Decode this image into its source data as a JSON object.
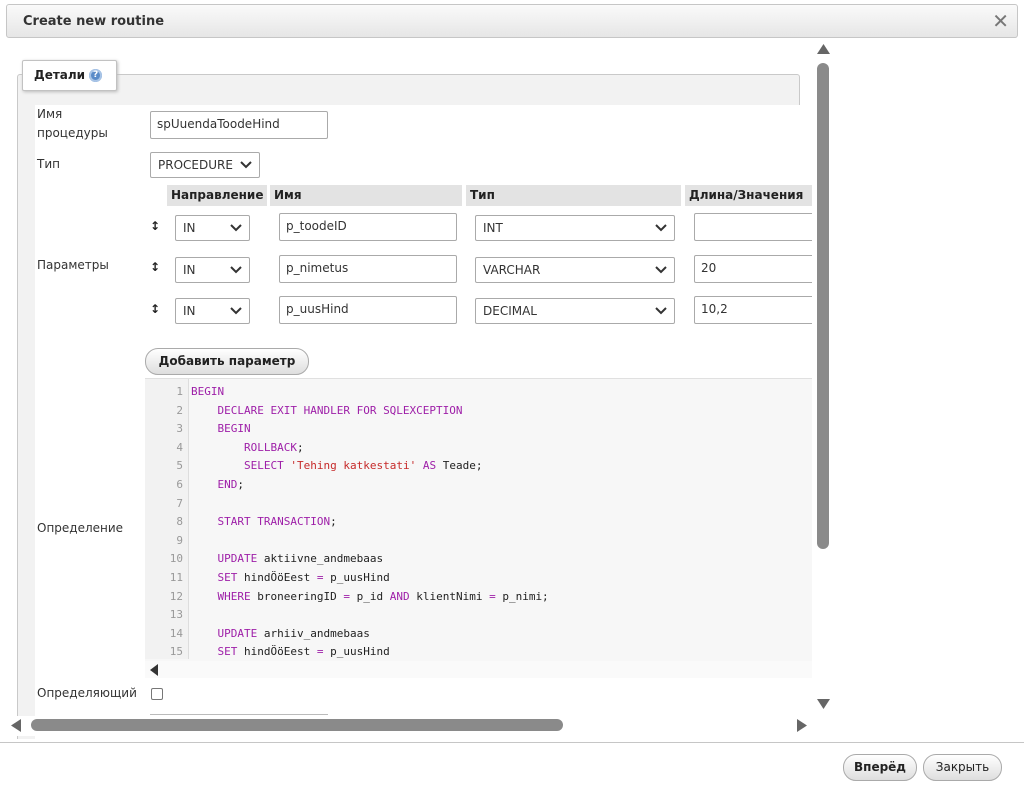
{
  "dialog": {
    "title": "Create new routine",
    "close_glyph": "✕"
  },
  "tab": {
    "label": "Детали",
    "help_icon": "help-icon"
  },
  "form": {
    "name_label": "Имя\nпроцедуры",
    "name_value": "spUuendaToodeHind",
    "type_label": "Тип",
    "type_value": "PROCEDURE",
    "params_label": "Параметры",
    "definition_label": "Определение",
    "deterministic_label": "Определяющий",
    "deterministic_checked": false
  },
  "params": {
    "headers": [
      "Направление",
      "Имя",
      "Тип",
      "Длина/Значения"
    ],
    "drag_glyph": "↕",
    "rows": [
      {
        "direction": "IN",
        "name": "p_toodeID",
        "type": "INT",
        "length": ""
      },
      {
        "direction": "IN",
        "name": "p_nimetus",
        "type": "VARCHAR",
        "length": "20"
      },
      {
        "direction": "IN",
        "name": "p_uusHind",
        "type": "DECIMAL",
        "length": "10,2"
      }
    ],
    "add_button": "Добавить параметр"
  },
  "code": {
    "colors": {
      "keyword": "#9e1fa8",
      "string": "#c62a2a",
      "plain": "#222222",
      "line_number": "#999999"
    },
    "lines": [
      [
        {
          "t": "k",
          "v": "BEGIN"
        }
      ],
      [
        {
          "t": "p",
          "v": "    "
        },
        {
          "t": "k",
          "v": "DECLARE EXIT HANDLER FOR SQLEXCEPTION"
        }
      ],
      [
        {
          "t": "p",
          "v": "    "
        },
        {
          "t": "k",
          "v": "BEGIN"
        }
      ],
      [
        {
          "t": "p",
          "v": "        "
        },
        {
          "t": "k",
          "v": "ROLLBACK"
        },
        {
          "t": "p",
          "v": ";"
        }
      ],
      [
        {
          "t": "p",
          "v": "        "
        },
        {
          "t": "k",
          "v": "SELECT"
        },
        {
          "t": "p",
          "v": " "
        },
        {
          "t": "s",
          "v": "'Tehing katkestati'"
        },
        {
          "t": "p",
          "v": " "
        },
        {
          "t": "k",
          "v": "AS"
        },
        {
          "t": "p",
          "v": " Teade;"
        }
      ],
      [
        {
          "t": "p",
          "v": "    "
        },
        {
          "t": "k",
          "v": "END"
        },
        {
          "t": "p",
          "v": ";"
        }
      ],
      [],
      [
        {
          "t": "p",
          "v": "    "
        },
        {
          "t": "k",
          "v": "START TRANSACTION"
        },
        {
          "t": "p",
          "v": ";"
        }
      ],
      [],
      [
        {
          "t": "p",
          "v": "    "
        },
        {
          "t": "k",
          "v": "UPDATE"
        },
        {
          "t": "p",
          "v": " aktiivne_andmebaas"
        }
      ],
      [
        {
          "t": "p",
          "v": "    "
        },
        {
          "t": "k",
          "v": "SET"
        },
        {
          "t": "p",
          "v": " hindÖöEest "
        },
        {
          "t": "k",
          "v": "="
        },
        {
          "t": "p",
          "v": " p_uusHind"
        }
      ],
      [
        {
          "t": "p",
          "v": "    "
        },
        {
          "t": "k",
          "v": "WHERE"
        },
        {
          "t": "p",
          "v": " broneeringID "
        },
        {
          "t": "k",
          "v": "="
        },
        {
          "t": "p",
          "v": " p_id "
        },
        {
          "t": "k",
          "v": "AND"
        },
        {
          "t": "p",
          "v": " klientNimi "
        },
        {
          "t": "k",
          "v": "="
        },
        {
          "t": "p",
          "v": " p_nimi;"
        }
      ],
      [],
      [
        {
          "t": "p",
          "v": "    "
        },
        {
          "t": "k",
          "v": "UPDATE"
        },
        {
          "t": "p",
          "v": " arhiiv_andmebaas"
        }
      ],
      [
        {
          "t": "p",
          "v": "    "
        },
        {
          "t": "k",
          "v": "SET"
        },
        {
          "t": "p",
          "v": " hindÖöEest "
        },
        {
          "t": "k",
          "v": "="
        },
        {
          "t": "p",
          "v": " p_uusHind"
        }
      ]
    ]
  },
  "footer": {
    "next_button": "Вперёд",
    "close_button": "Закрыть"
  }
}
